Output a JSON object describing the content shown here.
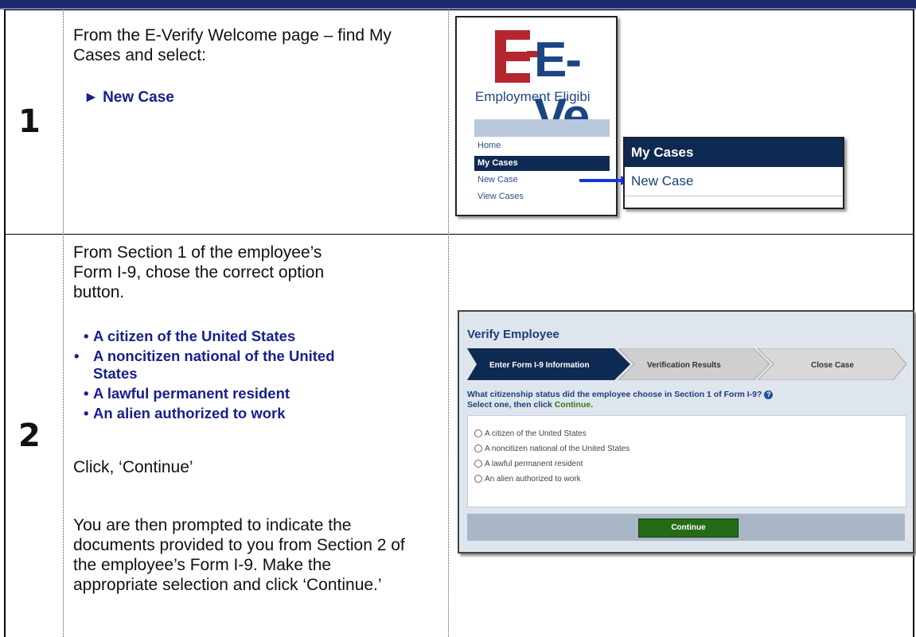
{
  "steps": [
    {
      "number": "1",
      "intro": "From the E-Verify Welcome page – find My Cases and select:",
      "action": "► New Case"
    },
    {
      "number": "2",
      "intro": "From Section 1 of the employee’s Form I-9, chose the correct option button.",
      "options": [
        "A citizen of the United States",
        "A noncitizen national of the United States",
        "A lawful permanent resident",
        "An alien authorized to work"
      ],
      "continue_text": "Click, ‘Continue’",
      "followup": "You are then prompted to indicate the documents provided to you from Section 2 of the employee’s Form I-9. Make the appropriate selection and click ‘Continue.’"
    }
  ],
  "shot1": {
    "logo": "E-Ve",
    "subtitle": "Employment Eligibi",
    "nav": [
      "Home",
      "My Cases",
      "New Case",
      "View Cases"
    ],
    "popup_header": "My Cases",
    "popup_item": "New Case"
  },
  "shot2": {
    "title": "Verify Employee",
    "crumbs": [
      "Enter Form I-9 Information",
      "Verification Results",
      "Close Case"
    ],
    "question": "What citizenship status did the employee choose in Section 1 of Form I-9?",
    "instruction_pre": "Select one, then click ",
    "instruction_link": "Continue",
    "instruction_post": ".",
    "help_icon": "?",
    "options": [
      "A citizen of the United States",
      "A noncitizen national of the United States",
      "A lawful permanent resident",
      "An alien authorized to work"
    ],
    "continue_button": "Continue"
  },
  "colors": {
    "header_bar": "#1b2a6b",
    "option_text": "#17208c",
    "nav_active": "#0f2a52",
    "continue_green": "#256b17"
  }
}
